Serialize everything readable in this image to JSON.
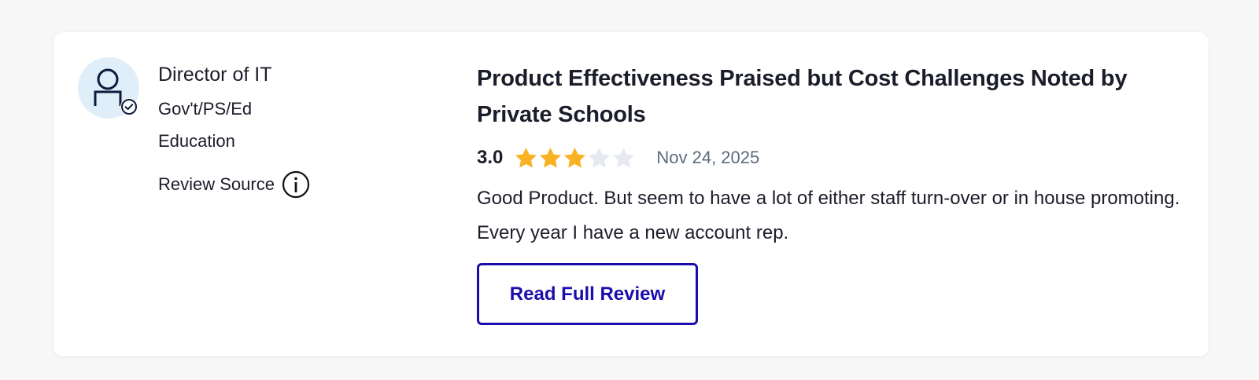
{
  "reviewer": {
    "role": "Director of IT",
    "segment": "Gov't/PS/Ed",
    "industry": "Education",
    "source_label": "Review Source",
    "avatar_icon": "user-verified-icon",
    "info_icon": "info-icon"
  },
  "review": {
    "title": "Product Effectiveness Praised but Cost Challenges Noted by Private Schools",
    "rating": "3.0",
    "rating_value": 3,
    "rating_max": 5,
    "date": "Nov 24, 2025",
    "text": "Good Product. But seem to have a lot of either staff turn-over or in house promoting. Every year I have a new account rep.",
    "button_label": "Read Full Review"
  },
  "colors": {
    "star_filled": "#f9b224",
    "star_empty": "#e6e9ef",
    "accent": "#1a0dab",
    "avatar_bg": "#dfeef8",
    "icon_stroke": "#0d1b3e"
  }
}
